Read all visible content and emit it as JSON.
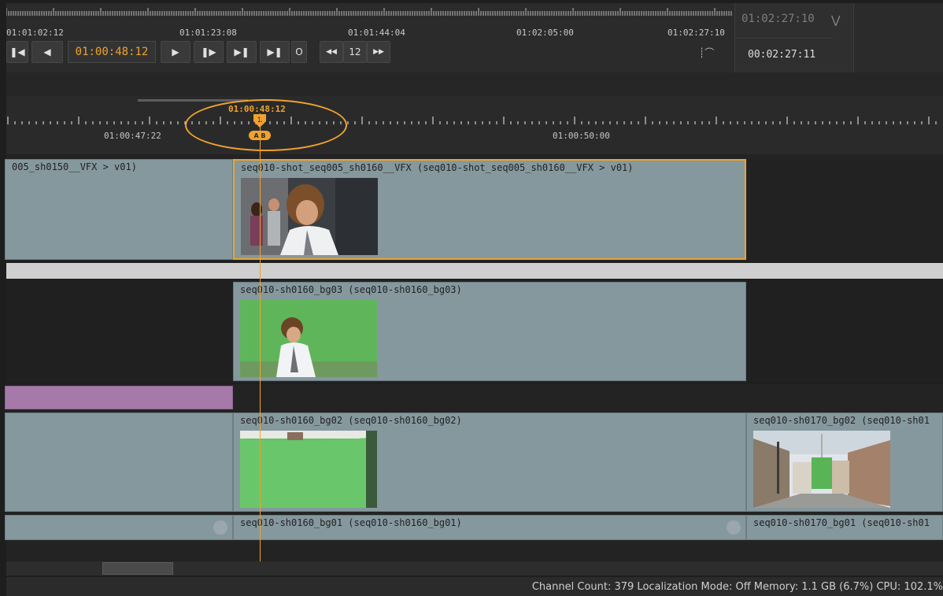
{
  "viewer": {
    "mini_ruler_timecodes": [
      "01:01:02:12",
      "01:01:23:08",
      "01:01:44:04",
      "01:02:05:00",
      "01:02:27:10"
    ],
    "end_timecode": "01:02:27:10",
    "duration_timecode": "00:02:27:11",
    "current_timecode": "01:00:48:12",
    "frame_increment": "12",
    "out_button": "O",
    "collapse_icon": "double-chevron-down-icon",
    "duration_icon": "duration-icon"
  },
  "timeline": {
    "ruler_timecodes": [
      "01:00:47:22",
      "01:00:50:00"
    ],
    "playhead_timecode": "01:00:48:12",
    "playhead_marker": "1",
    "playhead_badge": "A B"
  },
  "tracks": [
    {
      "clips": [
        {
          "name": "005_sh0150__VFX > v01)"
        },
        {
          "name": "seq010-shot_seq005_sh0160__VFX (seq010-shot_seq005_sh0160__VFX > v01)",
          "selected": true,
          "thumbnail": "boy-street-thumbnail"
        }
      ]
    },
    {
      "clips": [
        {
          "name": "seq010-sh0160_bg03 (seq010-sh0160_bg03)",
          "thumbnail": "boy-greenscreen-thumbnail"
        }
      ]
    },
    {
      "clips": [
        {
          "name": "",
          "color": "#a67aa8"
        }
      ]
    },
    {
      "clips": [
        {
          "name": "seq010-sh0160_bg02 (seq010-sh0160_bg02)",
          "thumbnail": "greenscreen-thumbnail"
        },
        {
          "name": "seq010-sh0170_bg02 (seq010-sh01",
          "thumbnail": "street-thumbnail"
        }
      ]
    },
    {
      "clips": [
        {
          "name": "seq010-sh0160_bg01 (seq010-sh0160_bg01)"
        },
        {
          "name": "seq010-sh0170_bg01 (seq010-sh01"
        }
      ]
    }
  ],
  "status_bar": {
    "text": "Channel Count: 379  Localization Mode: Off  Memory: 1.1 GB (6.7%) CPU: 102.1%"
  },
  "colors": {
    "accent": "#f0a22e",
    "clip": "#85989e",
    "purple_clip": "#a67aa8"
  }
}
